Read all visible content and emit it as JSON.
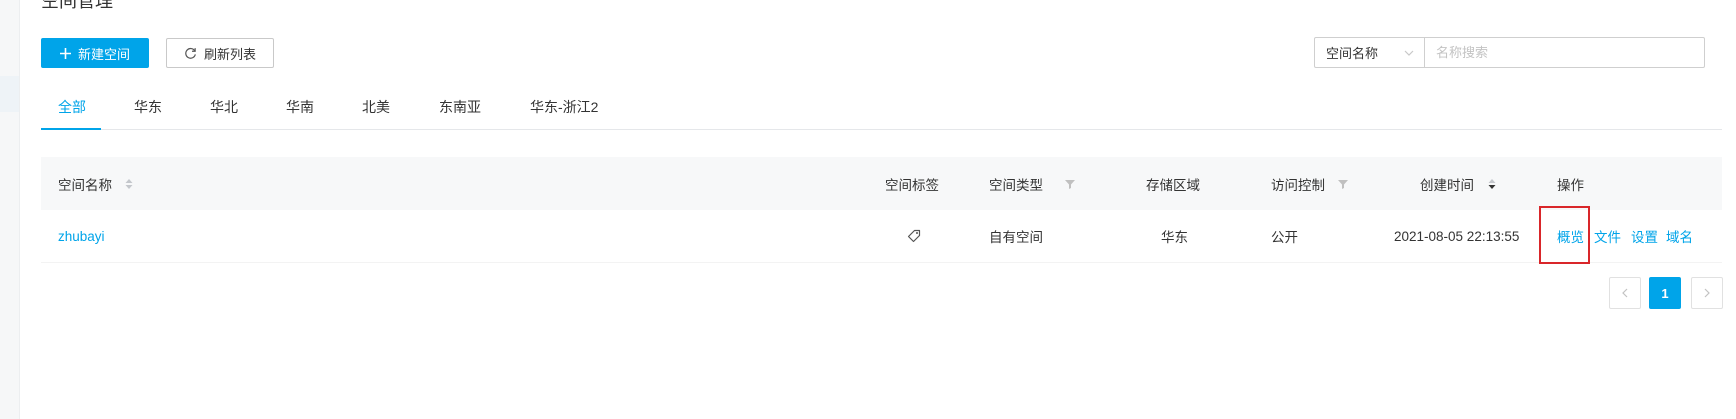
{
  "page": {
    "title": "空间管理"
  },
  "toolbar": {
    "create_icon": "plus-icon",
    "create_label": "新建空间",
    "refresh_icon": "refresh-icon",
    "refresh_label": "刷新列表",
    "search_field": "空间名称",
    "search_placeholder": "名称搜索",
    "search_value": ""
  },
  "tabs": [
    {
      "label": "全部",
      "active": true
    },
    {
      "label": "华东",
      "active": false
    },
    {
      "label": "华北",
      "active": false
    },
    {
      "label": "华南",
      "active": false
    },
    {
      "label": "北美",
      "active": false
    },
    {
      "label": "东南亚",
      "active": false
    },
    {
      "label": "华东-浙江2",
      "active": false
    }
  ],
  "table": {
    "headers": {
      "name": "空间名称",
      "tag": "空间标签",
      "type": "空间类型",
      "region": "存储区域",
      "access": "访问控制",
      "created": "创建时间",
      "actions": "操作"
    },
    "rows": [
      {
        "name": "zhubayi",
        "tag_icon": "tag-icon",
        "type": "自有空间",
        "region": "华东",
        "access": "公开",
        "created": "2021-08-05 22:13:55",
        "actions": [
          "概览",
          "文件",
          "设置",
          "域名"
        ]
      }
    ]
  },
  "pagination": {
    "current": "1",
    "prev_icon": "chevron-left-icon",
    "next_icon": "chevron-right-icon"
  },
  "colors": {
    "primary": "#00a4e9",
    "highlight_box": "#d9262a",
    "header_bg": "#f7f8f9"
  }
}
